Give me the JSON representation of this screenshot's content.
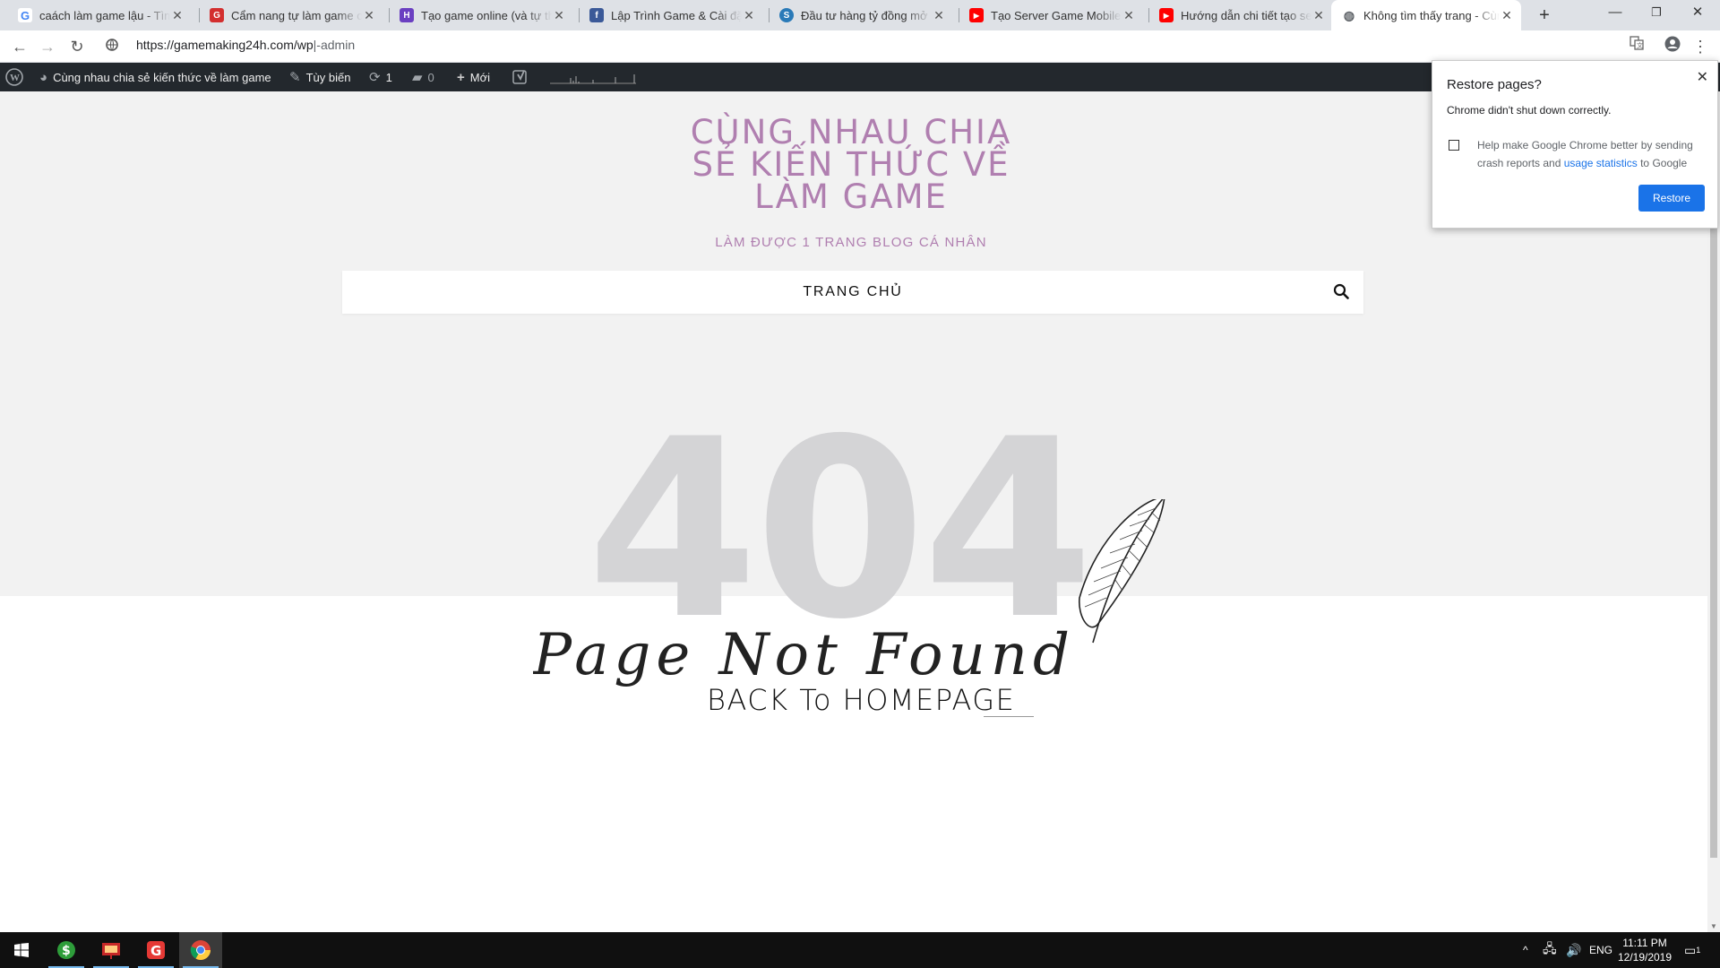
{
  "browser": {
    "tabs": [
      {
        "title": "caách làm game lậu - Tìm với Google",
        "icon": "google-icon",
        "color": "#4285f4"
      },
      {
        "title": "Cẩm nang tự làm game online",
        "icon": "gametv-icon",
        "color": "#d32f2f"
      },
      {
        "title": "Tạo game online (và tự thiết kế)",
        "icon": "puzzle-icon",
        "color": "#6a3fc1"
      },
      {
        "title": "Lập Trình Game & Cài đặt Máy chủ",
        "icon": "facebook-icon",
        "color": "#3b5998"
      },
      {
        "title": "Đầu tư hàng tỷ đồng mở server",
        "icon": "swirl-icon",
        "color": "#2a7ab8"
      },
      {
        "title": "Tạo Server Game Mobile Lậu",
        "icon": "youtube-icon",
        "color": "#ff0000"
      },
      {
        "title": "Hướng dẫn chi tiết tạo server",
        "icon": "youtube-icon",
        "color": "#ff0000"
      },
      {
        "title": "Không tìm thấy trang - Cùng nhau",
        "icon": "globe-icon",
        "color": "#5f6368"
      }
    ],
    "url_main": "https://gamemaking24h.com/wp",
    "url_rest": "admin"
  },
  "wp_admin_bar": {
    "site_name": "Cùng nhau chia sẻ kiến thức về làm game",
    "customize": "Tùy biến",
    "updates": "1",
    "comments": "0",
    "new": "Mới"
  },
  "site": {
    "title": "CÙNG NHAU CHIA SẺ KIẾN THỨC VỀ LÀM GAME",
    "tagline": "LÀM ĐƯỢC 1 TRANG BLOG CÁ NHÂN",
    "menu_home": "TRANG CHỦ"
  },
  "error_page": {
    "code": "404",
    "script_text": "Page Not Found",
    "back_link": "BACK To HOMEPAGE"
  },
  "restore_popup": {
    "title": "Restore pages?",
    "message": "Chrome didn't shut down correctly.",
    "help_prefix": "Help make Google Chrome better by sending crash reports and ",
    "help_link": "usage statistics",
    "help_suffix": " to Google",
    "button": "Restore"
  },
  "taskbar": {
    "lang": "ENG",
    "time": "11:11 PM",
    "date": "12/19/2019",
    "notifications": "1"
  },
  "colors": {
    "site_title": "#b07fb0",
    "wp_bar": "#23282d",
    "restore_button": "#1a73e8"
  }
}
